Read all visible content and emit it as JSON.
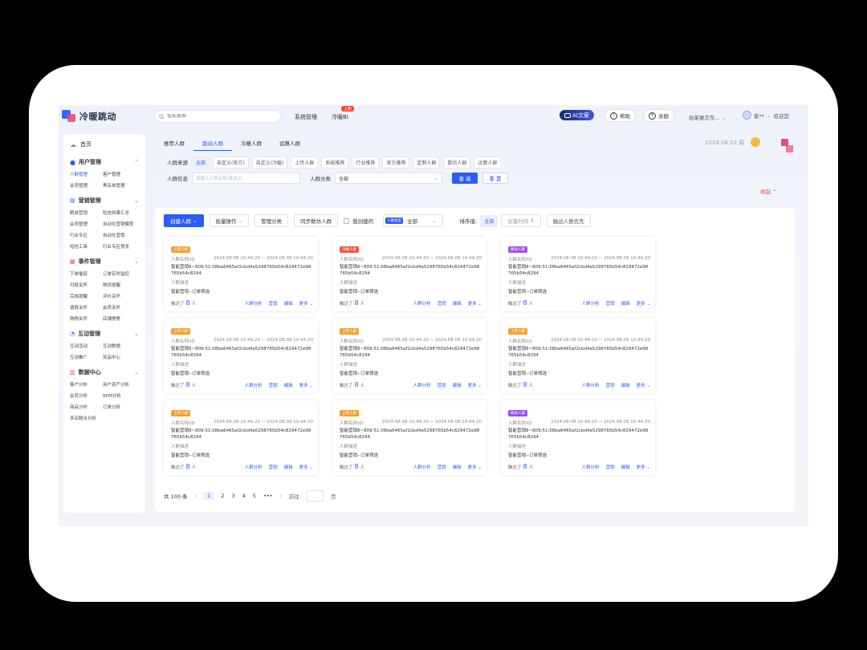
{
  "app": {
    "name": "冷暖跳动"
  },
  "search": {
    "placeholder": "智能搜索"
  },
  "topnav": {
    "system": "系统管理",
    "bi": "冷暖BI",
    "bi_badge": "上新"
  },
  "header_right": {
    "ai_label": "AI文案",
    "help": "帮助",
    "balance": "余额",
    "shop": "珀莱雅京东...",
    "user": "紫**",
    "welcome": "欢迎您"
  },
  "sidebar": {
    "home": "首页",
    "groups": [
      {
        "title": "用户管理",
        "items": [
          "人群管理",
          "客户管理",
          "会员管理",
          "黑名单管理"
        ]
      },
      {
        "title": "营销管理",
        "items": [
          "精准营销",
          "短信效果汇总",
          "会员管理",
          "自动化营销模型",
          "行业专区",
          "自动化营销",
          "短信工具",
          "行业专区预览"
        ]
      },
      {
        "title": "事件管理",
        "items": [
          "下单催促",
          "订单实时监控",
          "付款关怀",
          "物流提醒",
          "完成提醒",
          "评价关怀",
          "退款关怀",
          "会员关怀",
          "购物关怀",
          "店铺预警"
        ]
      },
      {
        "title": "互动管理",
        "items": [
          "互动活动",
          "互动数据",
          "互动推广",
          "奖品中心"
        ]
      },
      {
        "title": "数据中心",
        "items": [
          "客户分析",
          "用户资产分析",
          "会员分析",
          "RFM分析",
          "商品分析",
          "订单分析",
          "多店联合分析"
        ]
      }
    ]
  },
  "tabs": [
    "推荐人群",
    "跳动人群",
    "冷暖人群",
    "运算人群"
  ],
  "date": "2024.08.02 周",
  "filter": {
    "source_label": "人群来源",
    "source_chips": [
      "全部",
      "自定义(官方)",
      "自定义(冷暖)",
      "上传人群",
      "系统推荐",
      "行业推荐",
      "官方推荐",
      "定制人群",
      "数坊人群",
      "运算人群"
    ],
    "info_label": "人群信息",
    "info_placeholder": "请输入人群名称/描述ID",
    "category_label": "人群分类",
    "category_value": "全部",
    "query": "查 询",
    "reset": "重 置",
    "collapse": "收起"
  },
  "toolbar": {
    "create": "创建人群",
    "batch": "批量操作",
    "manage": "管理分类",
    "sync": "同步数坊人群",
    "mine": "我创建的",
    "type_tag": "人群类型",
    "type_value": "全部",
    "sort_label": "排序值:",
    "sort_all": "全部",
    "sort_time": "创建时间",
    "sort_reach": "触达人数优先"
  },
  "cards": [
    {
      "badge": "上传人群",
      "badge_color": "#f3a132",
      "name": "人群名称/ID",
      "time": "2024.08.08 10:44:20 ~ 2024.08.08 10:44:20",
      "id_text": "智能营销8~809:51:08ba6465af2cbd4a5298765b54c829472e98765b54c8294",
      "desc": "人群描述",
      "line": "智能营销--订单筛选",
      "reach_label": "触达了",
      "reach_num": "8",
      "reach_unit": "人",
      "a1": "人群分析",
      "a2": "营销",
      "a3": "编辑",
      "more": "更多"
    },
    {
      "badge": "冷暖人群",
      "badge_color": "#f0553c",
      "name": "人群名称/ID",
      "time": "2024.08.08 10:44:20 ~ 2024.08.08 10:44:20",
      "id_text": "智能营销8~809:51:08ba6465af2cbd4a5298765b54c829472e98765b54c8294",
      "desc": "人群描述",
      "line": "智能营销--订单筛选",
      "reach_label": "触达了",
      "reach_num": "8",
      "reach_unit": "人",
      "a1": "人群分析",
      "a2": "营销",
      "a3": "编辑",
      "more": "更多"
    },
    {
      "badge": "跳动人群",
      "badge_color": "#9b4fe8",
      "name": "人群名称/ID",
      "time": "2024.08.08 10:44:20 ~ 2024.08.08 10:44:20",
      "id_text": "智能营销8~809:51:08ba6465af2cbd4a5298765b54c829472e98765b54c8294",
      "desc": "人群描述",
      "line": "智能营销--订单筛选",
      "reach_label": "触达了",
      "reach_num": "8",
      "reach_unit": "人",
      "a1": "人群分析",
      "a2": "营销",
      "a3": "编辑",
      "more": "更多"
    },
    {
      "badge": "上传人群",
      "badge_color": "#f3a132",
      "name": "人群名称/ID",
      "time": "2024.08.08 10:44:20 ~ 2024.08.08 10:44:20",
      "id_text": "智能营销8~809:51:08ba6465af2cbd4a5298765b54c829472e98765b54c8294",
      "desc": "人群描述",
      "line": "智能营销--订单筛选",
      "reach_label": "触达了",
      "reach_num": "8",
      "reach_unit": "人",
      "a1": "人群分析",
      "a2": "营销",
      "a3": "编辑",
      "more": "更多"
    },
    {
      "badge": "上传人群",
      "badge_color": "#f3a132",
      "name": "人群名称/ID",
      "time": "2024.08.08 10:44:20 ~ 2024.08.08 10:44:20",
      "id_text": "智能营销8~809:51:08ba6465af2cbd4a5298765b54c829472e98765b54c8294",
      "desc": "人群描述",
      "line": "智能营销--订单筛选",
      "reach_label": "触达了",
      "reach_num": "8",
      "reach_unit": "人",
      "a1": "人群分析",
      "a2": "营销",
      "a3": "编辑",
      "more": "更多"
    },
    {
      "badge": "上传人群",
      "badge_color": "#f3a132",
      "name": "人群名称/ID",
      "time": "2024.08.08 10:44:20 ~ 2024.08.08 10:44:20",
      "id_text": "智能营销8~809:51:08ba6465af2cbd4a5298765b54c829472e98765b54c8294",
      "desc": "人群描述",
      "line": "智能营销--订单筛选",
      "reach_label": "触达了",
      "reach_num": "8",
      "reach_unit": "人",
      "a1": "人群分析",
      "a2": "营销",
      "a3": "编辑",
      "more": "更多"
    },
    {
      "badge": "上传人群",
      "badge_color": "#f3a132",
      "name": "人群名称/ID",
      "time": "2024.08.08 10:44:20 ~ 2024.08.08 10:44:20",
      "id_text": "智能营销8~809:51:08ba6465af2cbd4a5298765b54c829472e98765b54c8294",
      "desc": "人群描述",
      "line": "智能营销--订单筛选",
      "reach_label": "触达了",
      "reach_num": "8",
      "reach_unit": "人",
      "a1": "人群分析",
      "a2": "营销",
      "a3": "编辑",
      "more": "更多"
    },
    {
      "badge": "上传人群",
      "badge_color": "#f3a132",
      "name": "人群名称/ID",
      "time": "2024.08.08 10:44:20 ~ 2024.08.08 10:44:20",
      "id_text": "智能营销8~809:51:08ba6465af2cbd4a5298765b54c829472e98765b54c8294",
      "desc": "人群描述",
      "line": "智能营销--订单筛选",
      "reach_label": "触达了",
      "reach_num": "8",
      "reach_unit": "人",
      "a1": "人群分析",
      "a2": "营销",
      "a3": "编辑",
      "more": "更多"
    },
    {
      "badge": "跳动人群",
      "badge_color": "#9b4fe8",
      "name": "人群名称/ID",
      "time": "2024.08.08 10:44:20 ~ 2024.08.08 10:44:20",
      "id_text": "智能营销8~809:51:08ba6465af2cbd4a5298765b54c829472e98765b54c8294",
      "desc": "人群描述",
      "line": "智能营销--订单筛选",
      "reach_label": "触达了",
      "reach_num": "8",
      "reach_unit": "人",
      "a1": "人群分析",
      "a2": "营销",
      "a3": "编辑",
      "more": "更多"
    }
  ],
  "pager": {
    "total": "共 100 条",
    "pages": [
      "1",
      "2",
      "3",
      "4",
      "5"
    ],
    "ellipsis": "•••",
    "goto": "前往",
    "page_unit": "页"
  },
  "colors": {
    "accent": "#2d5cf6"
  }
}
